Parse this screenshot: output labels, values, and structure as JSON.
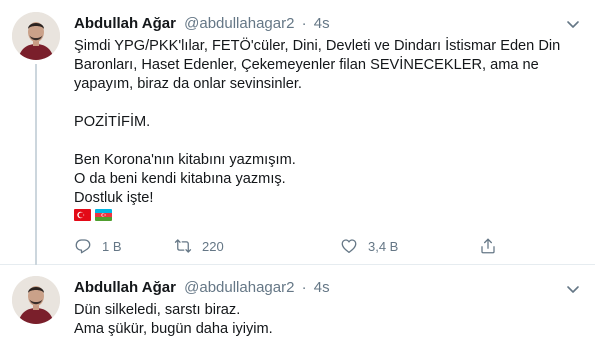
{
  "tweets": [
    {
      "author": {
        "name": "Abdullah Ağar",
        "handle": "@abdullahagar2"
      },
      "separator": "·",
      "time": "4s",
      "text_lines": [
        "Şimdi YPG/PKK'lılar, FETÖ'cüler, Dini, Devleti ve Dindarı İstismar Eden Din",
        "Baronları, Haset Edenler, Çekemeyenler filan SEVİNECEKLER, ama ne",
        "yapayım, biraz da onlar sevinsinler.",
        "",
        "POZİTİFİM.",
        "",
        "Ben Korona'nın kitabını yazmışım.",
        "O da beni kendi kitabına yazmış.",
        "Dostluk işte!"
      ],
      "flags": [
        "turkey-flag",
        "azerbaijan-flag"
      ],
      "actions": {
        "replies": "1 B",
        "retweets": "220",
        "likes": "3,4 B"
      },
      "icons": [
        "caret-down-icon",
        "reply-icon",
        "retweet-icon",
        "like-icon",
        "share-icon"
      ]
    },
    {
      "author": {
        "name": "Abdullah Ağar",
        "handle": "@abdullahagar2"
      },
      "separator": "·",
      "time": "4s",
      "text_lines": [
        "Dün silkeledi, sarstı biraz.",
        "Ama şükür, bugün daha iyiyim."
      ]
    }
  ],
  "colors": {
    "text": "#14171a",
    "secondary": "#657786",
    "divider": "#e6ecf0",
    "thread_line": "#ccd6dd",
    "turkey_red": "#e30a17",
    "az_blue": "#00b5e2",
    "az_red": "#ef3340",
    "az_green": "#509e2f"
  }
}
